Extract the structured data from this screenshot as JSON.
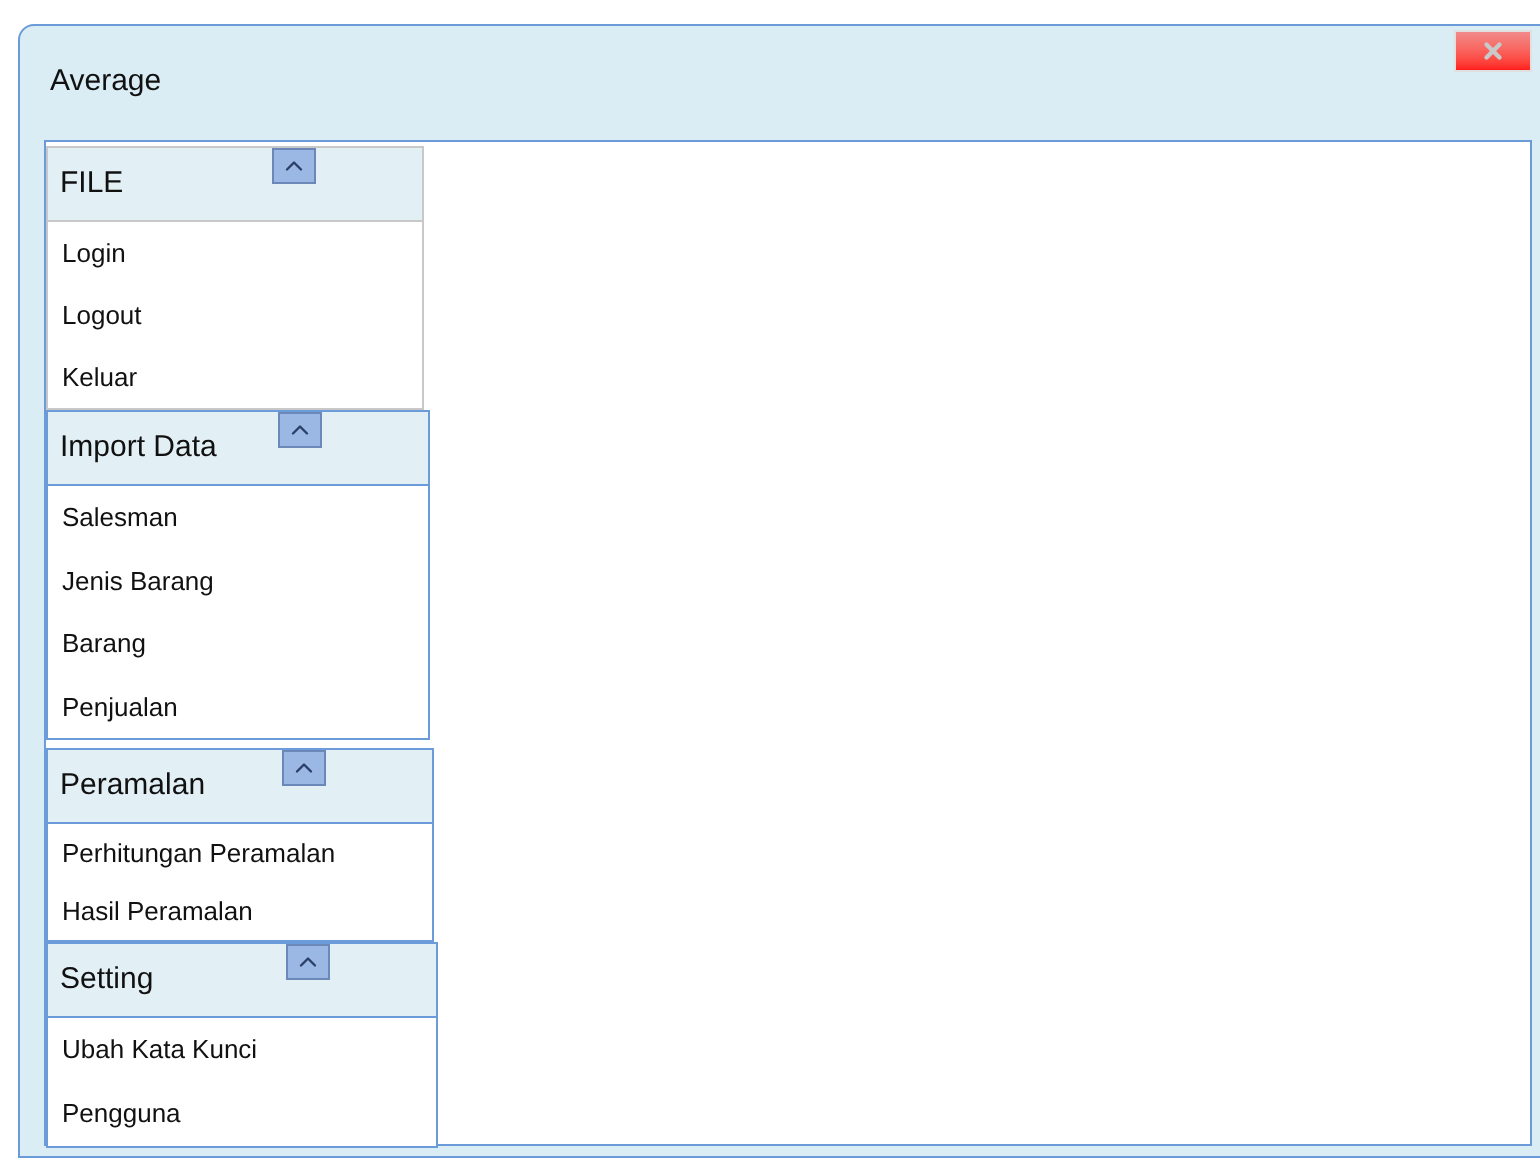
{
  "window": {
    "title": "Average"
  },
  "menu": [
    {
      "title": "FILE",
      "expanded": true,
      "items": [
        "Login",
        "Logout",
        "Keluar"
      ]
    },
    {
      "title": "Import Data",
      "expanded": true,
      "items": [
        "Salesman",
        "Jenis Barang",
        "Barang",
        "Penjualan"
      ]
    },
    {
      "title": "Peramalan",
      "expanded": true,
      "items": [
        "Perhitungan Peramalan",
        "Hasil Peramalan"
      ]
    },
    {
      "title": "Setting",
      "expanded": true,
      "items": [
        "Ubah Kata Kunci",
        "Pengguna"
      ]
    }
  ]
}
